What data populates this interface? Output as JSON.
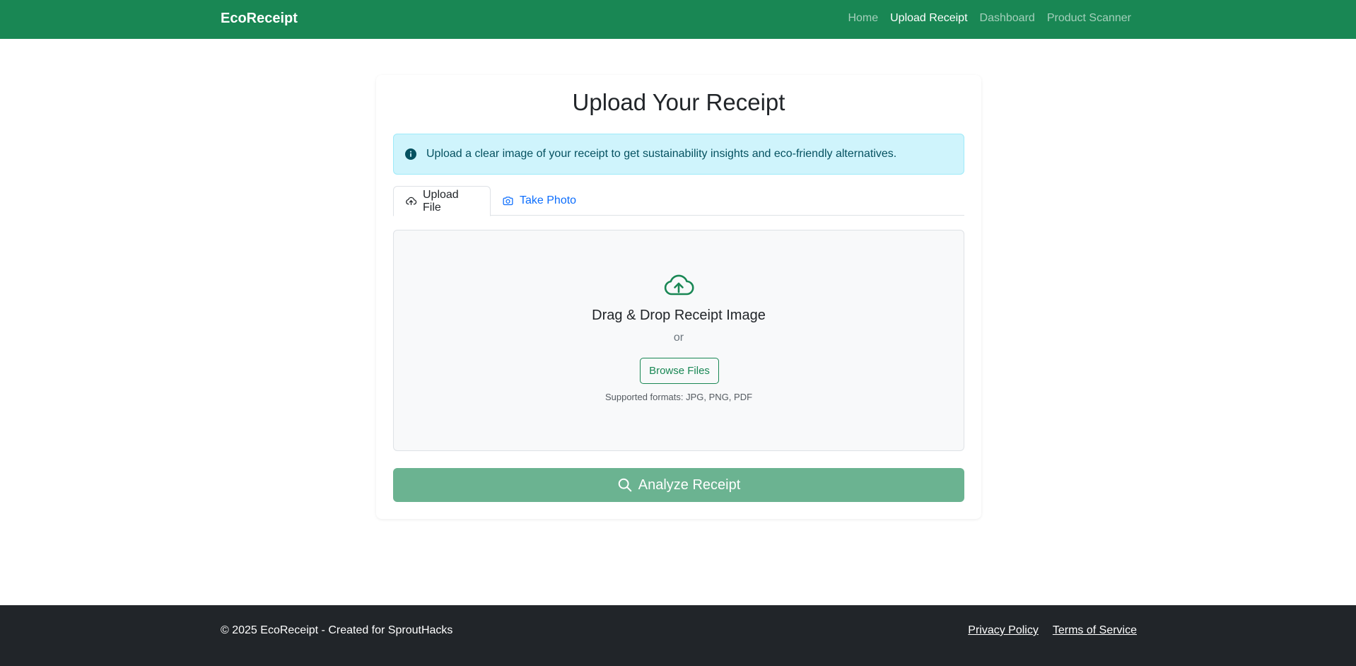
{
  "navbar": {
    "brand": "EcoReceipt",
    "links": [
      {
        "label": "Home",
        "active": false
      },
      {
        "label": "Upload Receipt",
        "active": true
      },
      {
        "label": "Dashboard",
        "active": false
      },
      {
        "label": "Product Scanner",
        "active": false
      }
    ]
  },
  "main": {
    "title": "Upload Your Receipt",
    "alert": {
      "icon": "info-circle-icon",
      "text": "Upload a clear image of your receipt to get sustainability insights and eco-friendly alternatives."
    },
    "tabs": [
      {
        "label": "Upload File",
        "icon": "cloud-upload-icon",
        "active": true
      },
      {
        "label": "Take Photo",
        "icon": "camera-icon",
        "active": false
      }
    ],
    "dropzone": {
      "icon": "cloud-upload-icon",
      "title": "Drag & Drop Receipt Image",
      "or_text": "or",
      "browse_label": "Browse Files",
      "formats": "Supported formats: JPG, PNG, PDF"
    },
    "analyze_label": "Analyze Receipt"
  },
  "footer": {
    "copyright": "© 2025 EcoReceipt - Created for SproutHacks",
    "links": [
      {
        "label": "Privacy Policy"
      },
      {
        "label": "Terms of Service"
      }
    ]
  },
  "colors": {
    "brand_green": "#198754",
    "analyze_disabled": "#6bb391",
    "alert_bg": "#cff4fc",
    "alert_text": "#055160",
    "link_blue": "#0d6efd",
    "footer_bg": "#212529"
  }
}
